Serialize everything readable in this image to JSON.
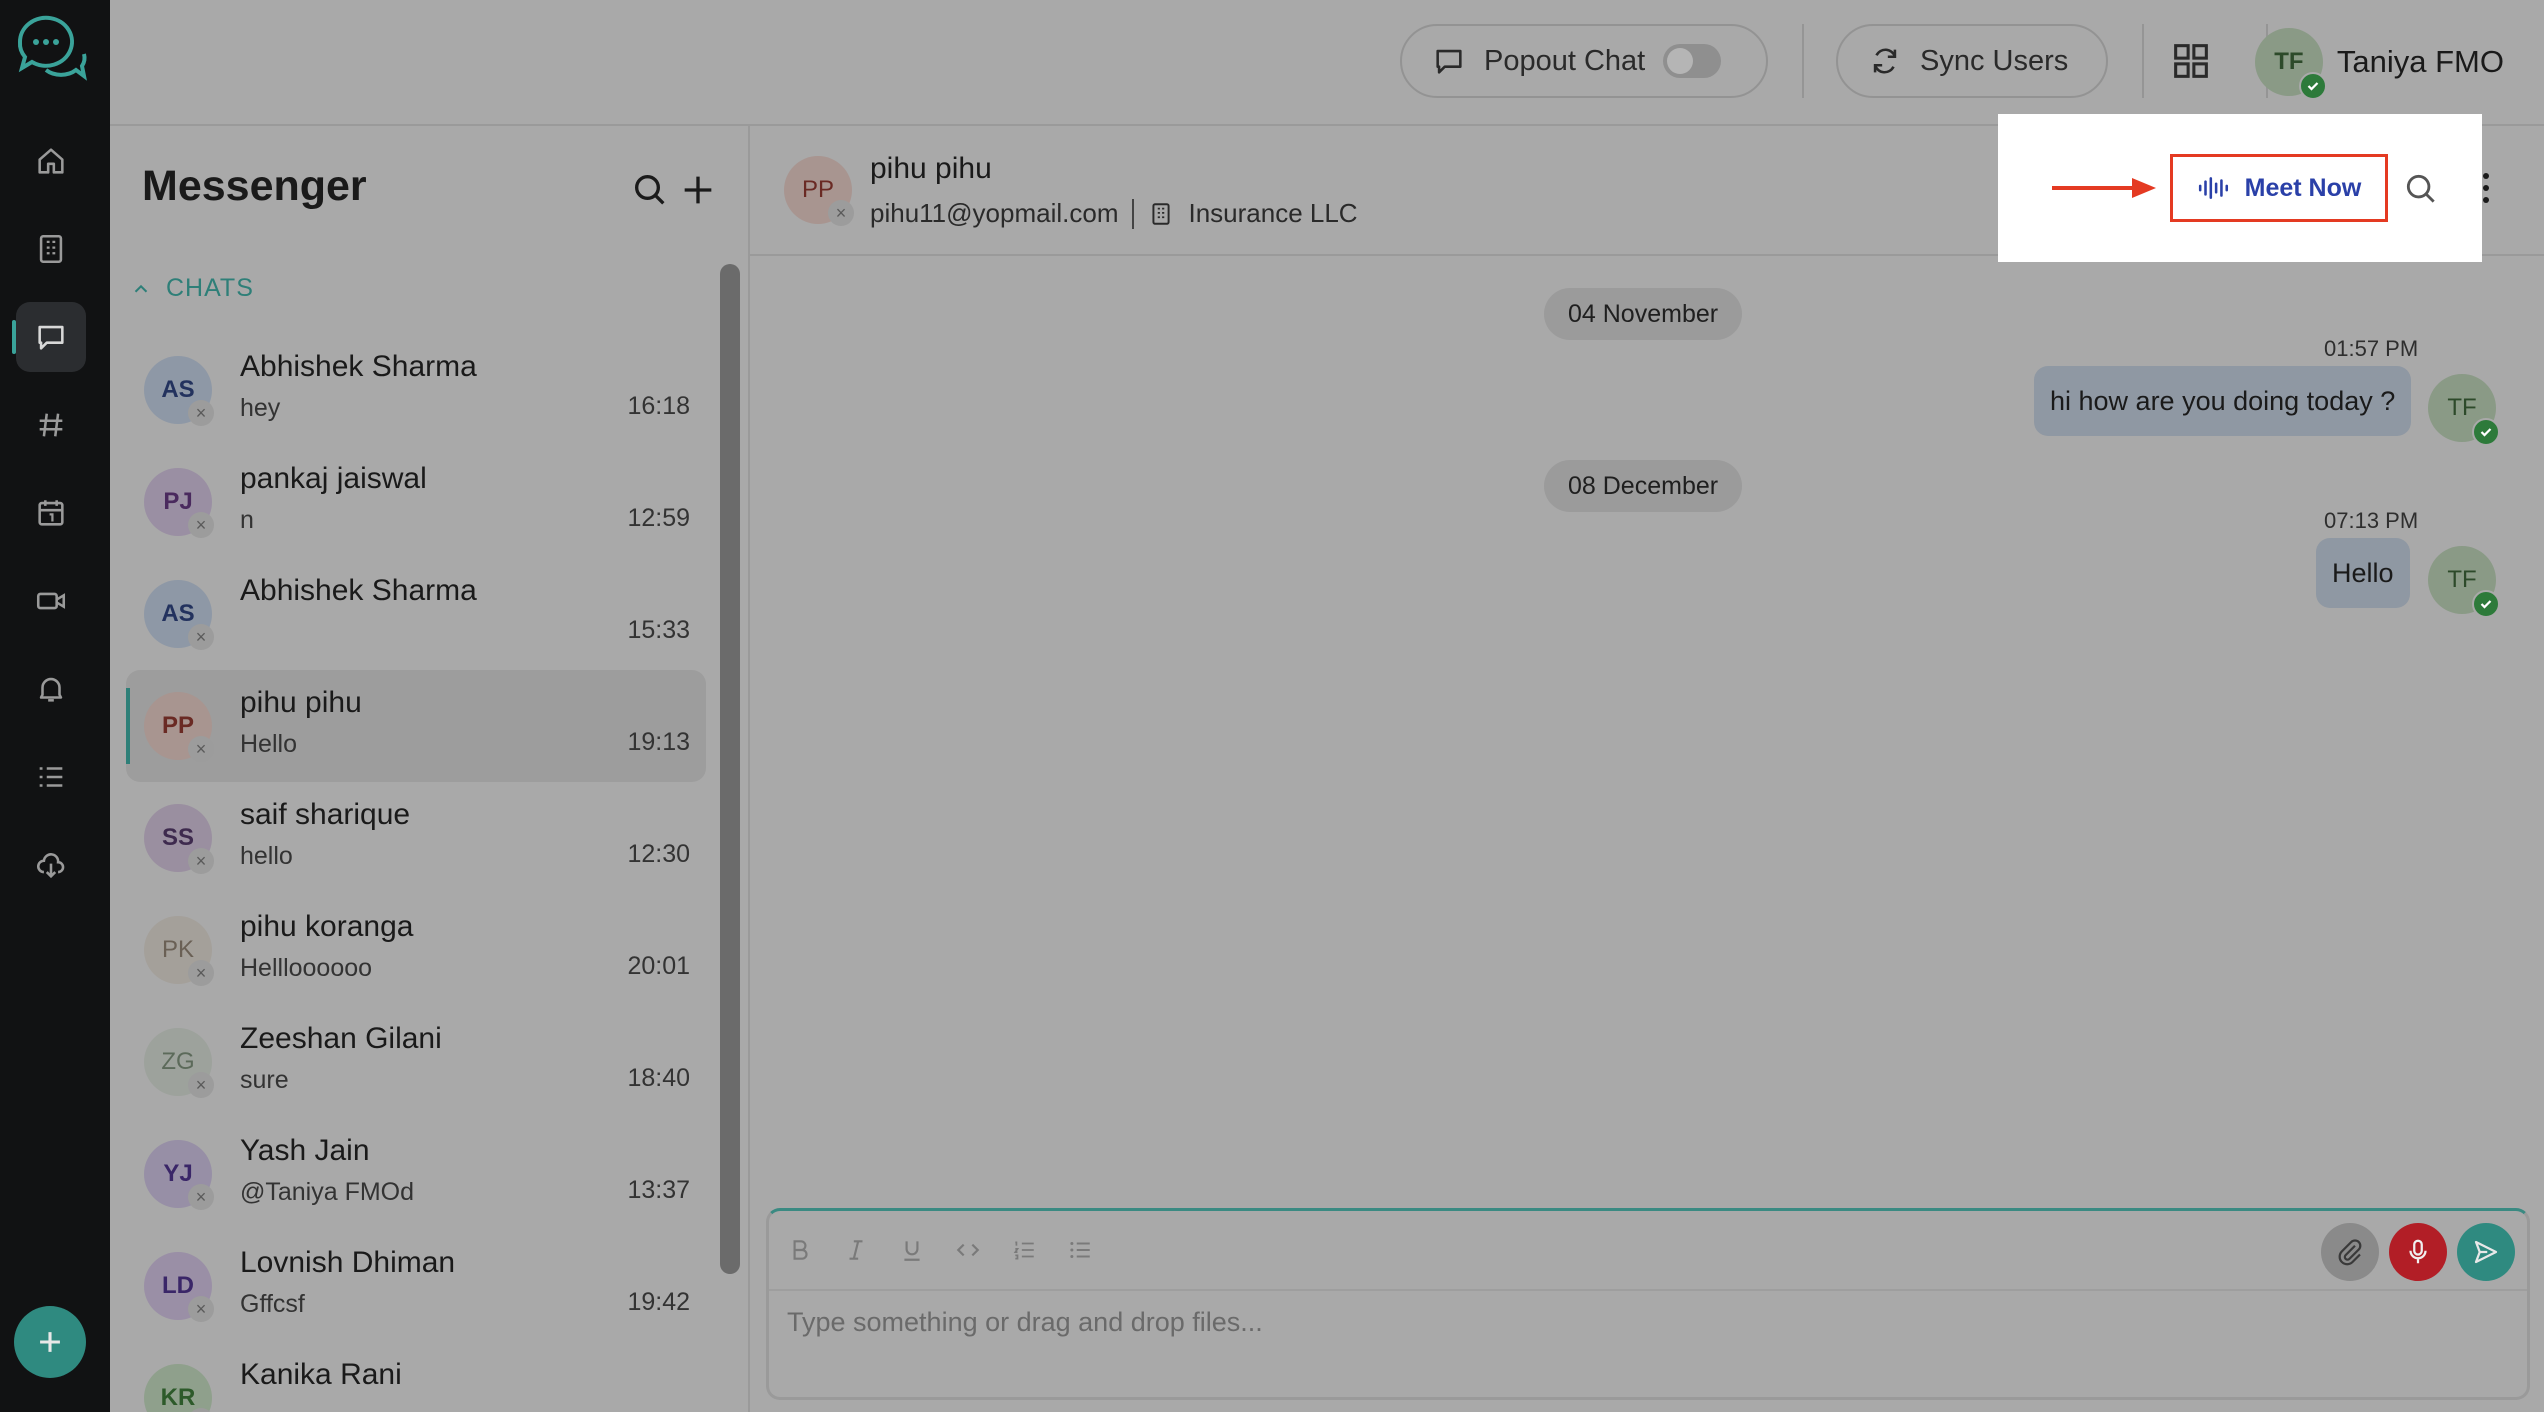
{
  "topbar": {
    "popout_label": "Popout Chat",
    "sync_label": "Sync Users",
    "user_initials": "TF",
    "user_name": "Taniya FMO"
  },
  "sidebar": {
    "title": "Messenger",
    "section_label": "CHATS",
    "chats": [
      {
        "initials": "AS",
        "name": "Abhishek Sharma",
        "preview": "hey",
        "time": "16:18"
      },
      {
        "initials": "PJ",
        "name": "pankaj jaiswal",
        "preview": "n",
        "time": "12:59"
      },
      {
        "initials": "AS",
        "name": "Abhishek Sharma",
        "preview": "",
        "time": "15:33"
      },
      {
        "initials": "PP",
        "name": "pihu pihu",
        "preview": "Hello",
        "time": "19:13"
      },
      {
        "initials": "SS",
        "name": "saif sharique",
        "preview": "hello",
        "time": "12:30"
      },
      {
        "initials": "PK",
        "name": "pihu koranga",
        "preview": "Hellloooooo",
        "time": "20:01"
      },
      {
        "initials": "ZG",
        "name": "Zeeshan Gilani",
        "preview": "sure",
        "time": "18:40"
      },
      {
        "initials": "YJ",
        "name": "Yash Jain",
        "preview": "@Taniya FMOd",
        "time": "13:37"
      },
      {
        "initials": "LD",
        "name": "Lovnish Dhiman",
        "preview": "Gffcsf",
        "time": "19:42"
      },
      {
        "initials": "KR",
        "name": "Kanika Rani",
        "preview": "",
        "time": ""
      }
    ]
  },
  "conversation": {
    "initials": "PP",
    "name": "pihu pihu",
    "email": "pihu11@yopmail.com",
    "company": "Insurance LLC",
    "meet_label": "Meet Now",
    "groups": [
      {
        "date": "04 November",
        "time": "01:57 PM",
        "text": "hi how are you doing today ?",
        "sender_initials": "TF"
      },
      {
        "date": "08 December",
        "time": "07:13 PM",
        "text": "Hello",
        "sender_initials": "TF"
      }
    ]
  },
  "composer": {
    "placeholder": "Type something or drag and drop files...",
    "format_buttons": [
      "bold-icon",
      "italic-icon",
      "underline-icon",
      "code-icon",
      "ordered-list-icon",
      "bullet-list-icon"
    ]
  },
  "colors": {
    "rail": "#111213",
    "accent": "#2e7f78",
    "highlight_border": "#e43a22",
    "meet_text": "#2a40a8",
    "mic": "#c0232b"
  }
}
